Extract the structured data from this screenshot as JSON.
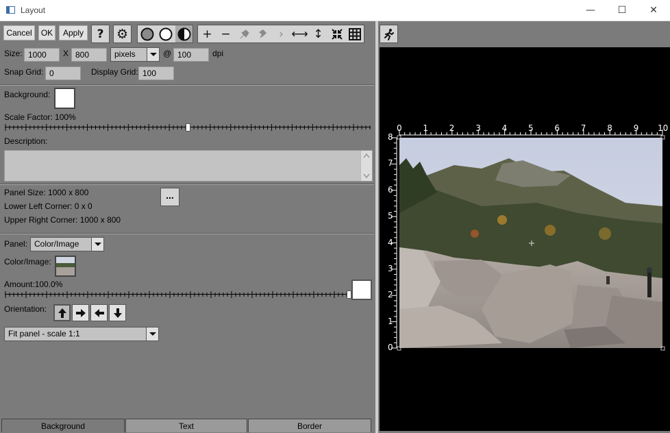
{
  "window": {
    "title": "Layout",
    "minimize_glyph": "—",
    "maximize_glyph": "☐",
    "close_glyph": "✕"
  },
  "toolbar": {
    "cancel_label": "Cancel",
    "ok_label": "OK",
    "apply_label": "Apply",
    "icons": [
      "help-icon",
      "settings-gear-icon",
      "circle-filled-icon",
      "circle-outline-icon",
      "circle-half-icon",
      "add-icon",
      "remove-icon",
      "pin-left-icon",
      "pin-right-icon",
      "chevron-right-icon",
      "stretch-horizontal-icon",
      "stretch-vertical-icon",
      "shrink-icon",
      "grid-icon"
    ],
    "glyphs": {
      "help": "?",
      "gear": "⚙",
      "add": "+",
      "remove": "−",
      "chevron": "›",
      "h": "⟷",
      "v": "↕"
    }
  },
  "size": {
    "label": "Size:",
    "width": "1000",
    "x_label": "X",
    "height": "800",
    "unit": "pixels",
    "at_label": "@",
    "resolution": "100",
    "res_unit": "dpi"
  },
  "grid": {
    "snap_label": "Snap Grid:",
    "snap_value": "0",
    "display_label": "Display Grid:",
    "display_value": "100"
  },
  "background": {
    "label": "Background:",
    "color": "#ffffff",
    "scale_label": "Scale Factor: 100%",
    "scale_fraction": 0.5,
    "description_label": "Description:",
    "description_value": ""
  },
  "panel_info": {
    "panel_size": "Panel Size: 1000 x 800",
    "lower_left": "Lower Left Corner: 0 x 0",
    "upper_right": "Upper Right Corner: 1000 x 800",
    "more_label": "..."
  },
  "panel": {
    "label": "Panel:",
    "type": "Color/Image",
    "color_image_label": "Color/Image:",
    "amount_label": "Amount:100.0%",
    "amount_fraction": 1.0,
    "amount_color": "#ffffff",
    "orientation_label": "Orientation:",
    "orientation_glyphs": [
      "🡅",
      "🡆",
      "🡄",
      "🡇"
    ],
    "fit_mode": "Fit panel - scale 1:1"
  },
  "tabs": [
    {
      "label": "Background",
      "active": true
    },
    {
      "label": "Text",
      "active": false
    },
    {
      "label": "Border",
      "active": false
    }
  ],
  "preview": {
    "run_icon": "running-person-icon",
    "ruler_x": [
      "0",
      "1",
      "2",
      "3",
      "4",
      "5",
      "6",
      "7",
      "8",
      "9",
      "10"
    ],
    "ruler_y": [
      "8",
      "7",
      "6",
      "5",
      "4",
      "3",
      "2",
      "1",
      "0"
    ]
  }
}
